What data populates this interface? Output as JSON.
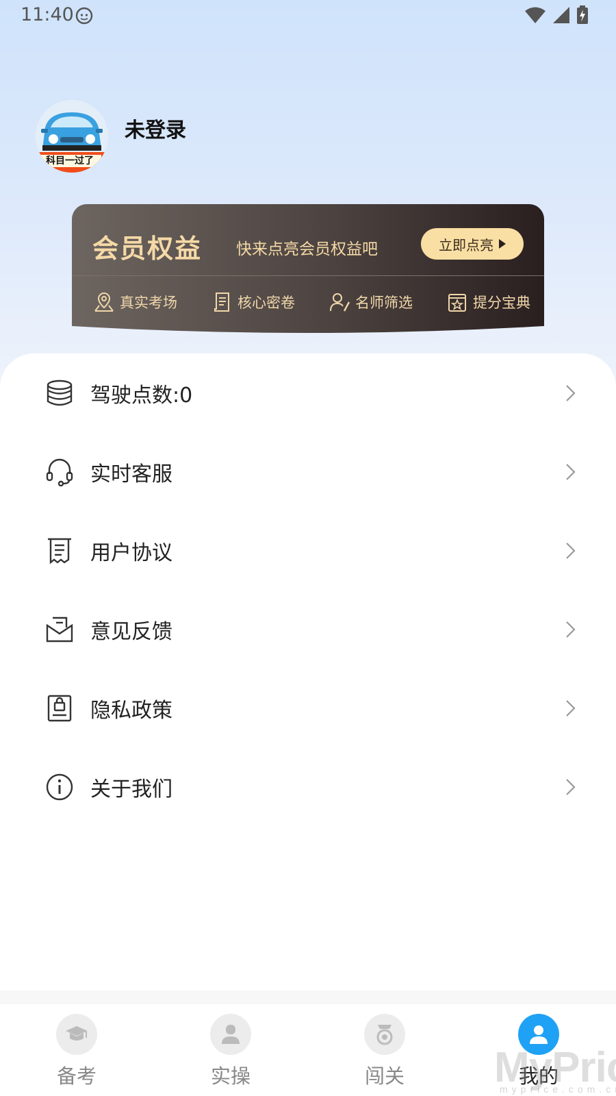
{
  "status_bar": {
    "time": "11:40"
  },
  "profile": {
    "username": "未登录",
    "avatar_caption": "科目一过了"
  },
  "vip_card": {
    "title": "会员权益",
    "subtitle": "快来点亮会员权益吧",
    "button_label": "立即点亮",
    "features": [
      {
        "label": "真实考场",
        "icon": "location-icon"
      },
      {
        "label": "核心密卷",
        "icon": "document-icon"
      },
      {
        "label": "名师筛选",
        "icon": "teacher-icon"
      },
      {
        "label": "提分宝典",
        "icon": "star-book-icon"
      }
    ]
  },
  "menu": {
    "items": [
      {
        "label": "驾驶点数:0",
        "icon": "coins-icon"
      },
      {
        "label": "实时客服",
        "icon": "headset-icon"
      },
      {
        "label": "用户协议",
        "icon": "receipt-icon"
      },
      {
        "label": "意见反馈",
        "icon": "feedback-mail-icon"
      },
      {
        "label": "隐私政策",
        "icon": "privacy-lock-icon"
      },
      {
        "label": "关于我们",
        "icon": "info-icon"
      }
    ]
  },
  "bottom_nav": {
    "tabs": [
      {
        "label": "备考",
        "icon": "graduation-cap-icon",
        "active": false
      },
      {
        "label": "实操",
        "icon": "person-icon",
        "active": false
      },
      {
        "label": "闯关",
        "icon": "medal-icon",
        "active": false
      },
      {
        "label": "我的",
        "icon": "user-icon",
        "active": true
      }
    ]
  },
  "watermark": {
    "text": "MyPrice",
    "subtext": "myprice.com.cn"
  },
  "colors": {
    "accent": "#1fa2f5",
    "vip_gold": "#f5d9a6",
    "vip_dark": "#2a1f1f"
  }
}
